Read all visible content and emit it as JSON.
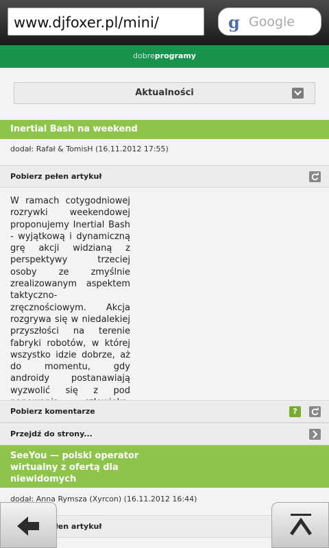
{
  "browser": {
    "url": "www.djfoxer.pl/mini/",
    "search_logo": "g",
    "search_label": "Google"
  },
  "site": {
    "logo_light": "dobre",
    "logo_bold": "programy"
  },
  "category": {
    "selected": "Aktualności"
  },
  "articles": [
    {
      "title": "Inertial Bash na weekend",
      "meta": "dodał: Rafał & TomisH (16.11.2012 17:55)",
      "full_article_label": "Pobierz pełen artykuł",
      "lead": "W ramach cotygodniowej rozrywki weekendowej proponujemy Inertial Bash - wyjątkową i dynamiczną grę akcji widzianą z perspektywy trzeciej osoby ze zmyślnie zrealizowanym aspektem taktyczno-zręcznościowym. Akcja rozgrywa się w niedalekiej przyszłości na terenie fabryki robotów, w której wszystko idzie dobrze, aż do momentu, gdy androidy postanawiają wyzwolić się z pod panowania człowieka, przejąć...",
      "comments_label": "Pobierz komentarze",
      "goto_label": "Przejdź do strony..."
    },
    {
      "title": "SeeYou — polski operator wirtualny z ofertą dla niewidomych",
      "meta": "dodał: Anna Rymsza (Xyrcon) (16.11.2012 16:44)",
      "full_article_label": "Pobierz pełen artykuł"
    }
  ],
  "icons": {
    "dropdown": "chevron-down-icon",
    "refresh": "refresh-icon",
    "help": "help-icon",
    "arrow": "chevron-right-icon",
    "back": "back-arrow-icon",
    "top": "scroll-top-icon"
  },
  "colors": {
    "header_green": "#17934d",
    "title_green": "#8ec44a",
    "help_green": "#77ad2e"
  },
  "help_icon_glyph": "?"
}
